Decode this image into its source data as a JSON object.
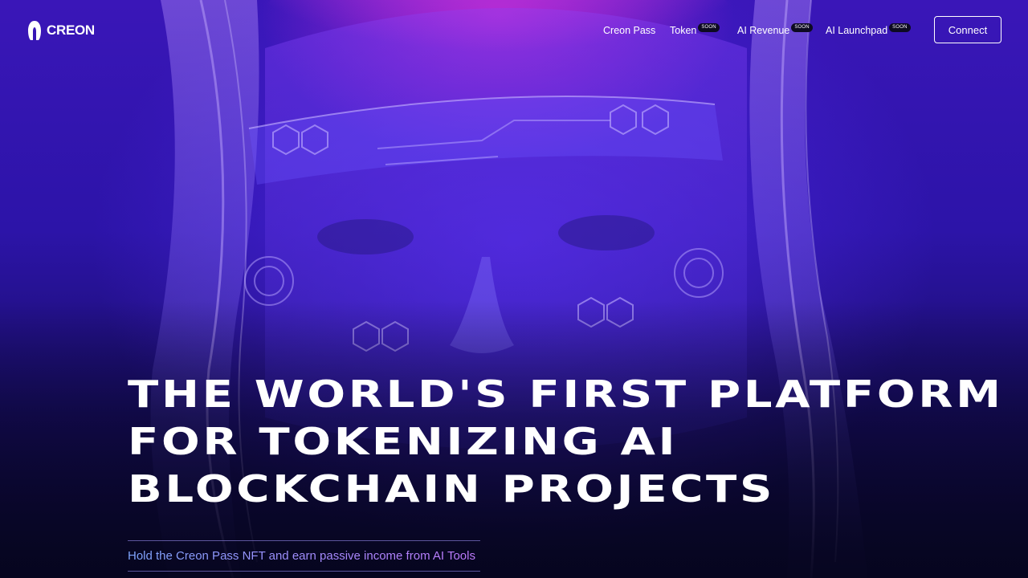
{
  "brand": {
    "name": "CREON",
    "logo_icon": "creon-logo-icon"
  },
  "nav": {
    "items": [
      {
        "label": "Creon Pass",
        "badge": ""
      },
      {
        "label": "Token",
        "badge": "SOON"
      },
      {
        "label": "AI Revenue",
        "badge": "SOON"
      },
      {
        "label": "AI Launchpad",
        "badge": "SOON"
      }
    ],
    "connect_label": "Connect"
  },
  "hero": {
    "headline_lines": [
      "THE WORLD'S FIRST PLATFORM",
      "FOR TOKENIZING AI",
      "BLOCKCHAIN PROJECTS"
    ],
    "subtitle": "Hold the Creon Pass NFT and earn passive income from AI Tools"
  },
  "colors": {
    "background": "#2c14a8",
    "accent_pink": "#be28d2",
    "subtitle_gradient_start": "#7fa6ff",
    "subtitle_gradient_end": "#c07bff"
  }
}
